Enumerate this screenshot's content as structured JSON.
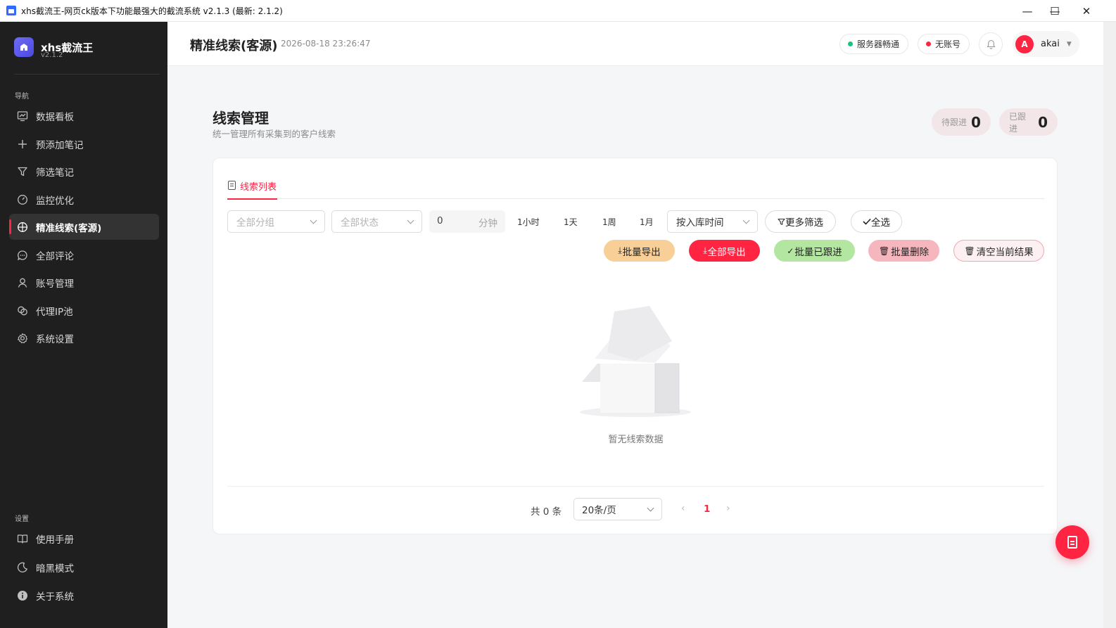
{
  "window": {
    "title": "xhs截流王-网页ck版本下功能最强大的截流系统 v2.1.3 (最新: 2.1.2)",
    "minimize": "—",
    "maximize": "☐",
    "close": "✕"
  },
  "brand": {
    "name": "xhs截流王",
    "version": "v2.1.2"
  },
  "sidebar": {
    "nav_title": "导航",
    "items": [
      {
        "label": "数据看板",
        "icon": "chart-icon"
      },
      {
        "label": "预添加笔记",
        "icon": "plus-icon"
      },
      {
        "label": "筛选笔记",
        "icon": "filter-icon"
      },
      {
        "label": "监控优化",
        "icon": "gauge-icon"
      },
      {
        "label": "精准线索(客源)",
        "icon": "target-icon",
        "active": true
      },
      {
        "label": "全部评论",
        "icon": "comment-icon"
      },
      {
        "label": "账号管理",
        "icon": "user-icon"
      },
      {
        "label": "代理IP池",
        "icon": "link-icon"
      },
      {
        "label": "系统设置",
        "icon": "gear-icon"
      }
    ],
    "settings_title": "设置",
    "settings_items": [
      {
        "label": "使用手册",
        "icon": "book-icon"
      },
      {
        "label": "暗黑模式",
        "icon": "moon-icon"
      },
      {
        "label": "关于系统",
        "icon": "info-icon"
      }
    ]
  },
  "header": {
    "title": "精准线索(客源)",
    "time": "2026-08-18 23:26:47",
    "server_status": "服务器畅通",
    "account_status": "无账号",
    "user_initial": "A",
    "user_name": "akai",
    "colors": {
      "ok": "#19c37d",
      "warn": "#ff2442"
    }
  },
  "main": {
    "title": "线索管理",
    "subtitle": "统一管理所有采集到的客户线索",
    "stats": [
      {
        "label": "待跟进",
        "value": "0"
      },
      {
        "label": "已跟进",
        "value": "0"
      }
    ],
    "tab": "线索列表",
    "filters": {
      "group_placeholder": "全部分组",
      "status_placeholder": "全部状态",
      "minutes_value": "0",
      "minutes_unit": "分钟",
      "quick": [
        "1小时",
        "1天",
        "1周",
        "1月"
      ],
      "sort": "按入库时间",
      "more": "更多筛选",
      "select_all": "全选"
    },
    "actions": {
      "batch_export": "批量导出",
      "export_all": "全部导出",
      "batch_followed": "批量已跟进",
      "batch_delete": "批量删除",
      "clear_results": "清空当前结果"
    },
    "empty_text": "暂无线索数据",
    "pagination": {
      "total": "共 0 条",
      "page_size": "20条/页",
      "current": "1",
      "prev": "‹",
      "next": "›"
    }
  },
  "accent": "#ff2442"
}
